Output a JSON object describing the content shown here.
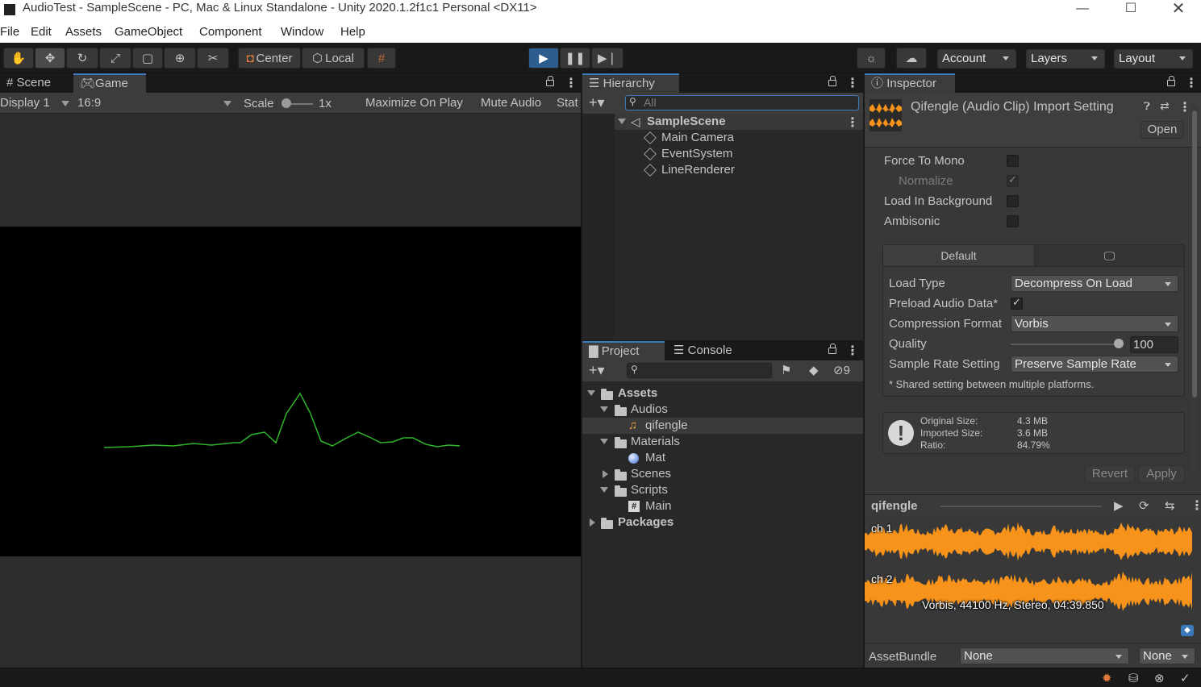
{
  "window": {
    "title": "AudioTest - SampleScene - PC, Mac & Linux Standalone - Unity 2020.1.2f1c1 Personal <DX11>"
  },
  "menu": [
    "File",
    "Edit",
    "Assets",
    "GameObject",
    "Component",
    "Window",
    "Help"
  ],
  "toolbar": {
    "pivot": "Center",
    "space": "Local",
    "account": "Account",
    "layers": "Layers",
    "layout": "Layout"
  },
  "game_panel": {
    "tab_scene": "Scene",
    "tab_game": "Game",
    "display": "Display 1",
    "aspect": "16:9",
    "scale_label": "Scale",
    "scale_value": "1x",
    "maximize": "Maximize On Play",
    "mute": "Mute Audio",
    "stats": "Stat",
    "line_color": "#2fb52a"
  },
  "hierarchy": {
    "tab": "Hierarchy",
    "search_placeholder": "All",
    "scene": "SampleScene",
    "objects": [
      "Main Camera",
      "EventSystem",
      "LineRenderer"
    ]
  },
  "project": {
    "tab_project": "Project",
    "tab_console": "Console",
    "hidden_count": "9",
    "tree": {
      "assets": "Assets",
      "audios": "Audios",
      "qifengle": "qifengle",
      "materials": "Materials",
      "mat": "Mat",
      "scenes": "Scenes",
      "scripts": "Scripts",
      "main": "Main",
      "packages": "Packages"
    }
  },
  "inspector": {
    "tab": "Inspector",
    "header": "Qifengle (Audio Clip) Import Setting",
    "open": "Open",
    "force_mono": "Force To Mono",
    "normalize": "Normalize",
    "load_bg": "Load In Background",
    "ambisonic": "Ambisonic",
    "platform_default": "Default",
    "load_type_label": "Load Type",
    "load_type": "Decompress On Load",
    "preload_label": "Preload Audio Data*",
    "compression_label": "Compression Format",
    "compression": "Vorbis",
    "quality_label": "Quality",
    "quality": "100",
    "sample_rate_label": "Sample Rate Setting",
    "sample_rate": "Preserve Sample Rate",
    "shared_note": "* Shared setting between multiple platforms.",
    "original_size_label": "Original Size:",
    "original_size": "4.3 MB",
    "imported_size_label": "Imported Size:",
    "imported_size": "3.6 MB",
    "ratio_label": "Ratio:",
    "ratio": "84.79%",
    "revert": "Revert",
    "apply": "Apply",
    "preview_name": "qifengle",
    "ch1": "ch 1",
    "ch2": "ch 2",
    "clip_info": "Vorbis, 44100 Hz, Stereo, 04:39.850",
    "assetbundle_label": "AssetBundle",
    "assetbundle": "None",
    "variant": "None",
    "waveform_color": "#f7931a"
  }
}
